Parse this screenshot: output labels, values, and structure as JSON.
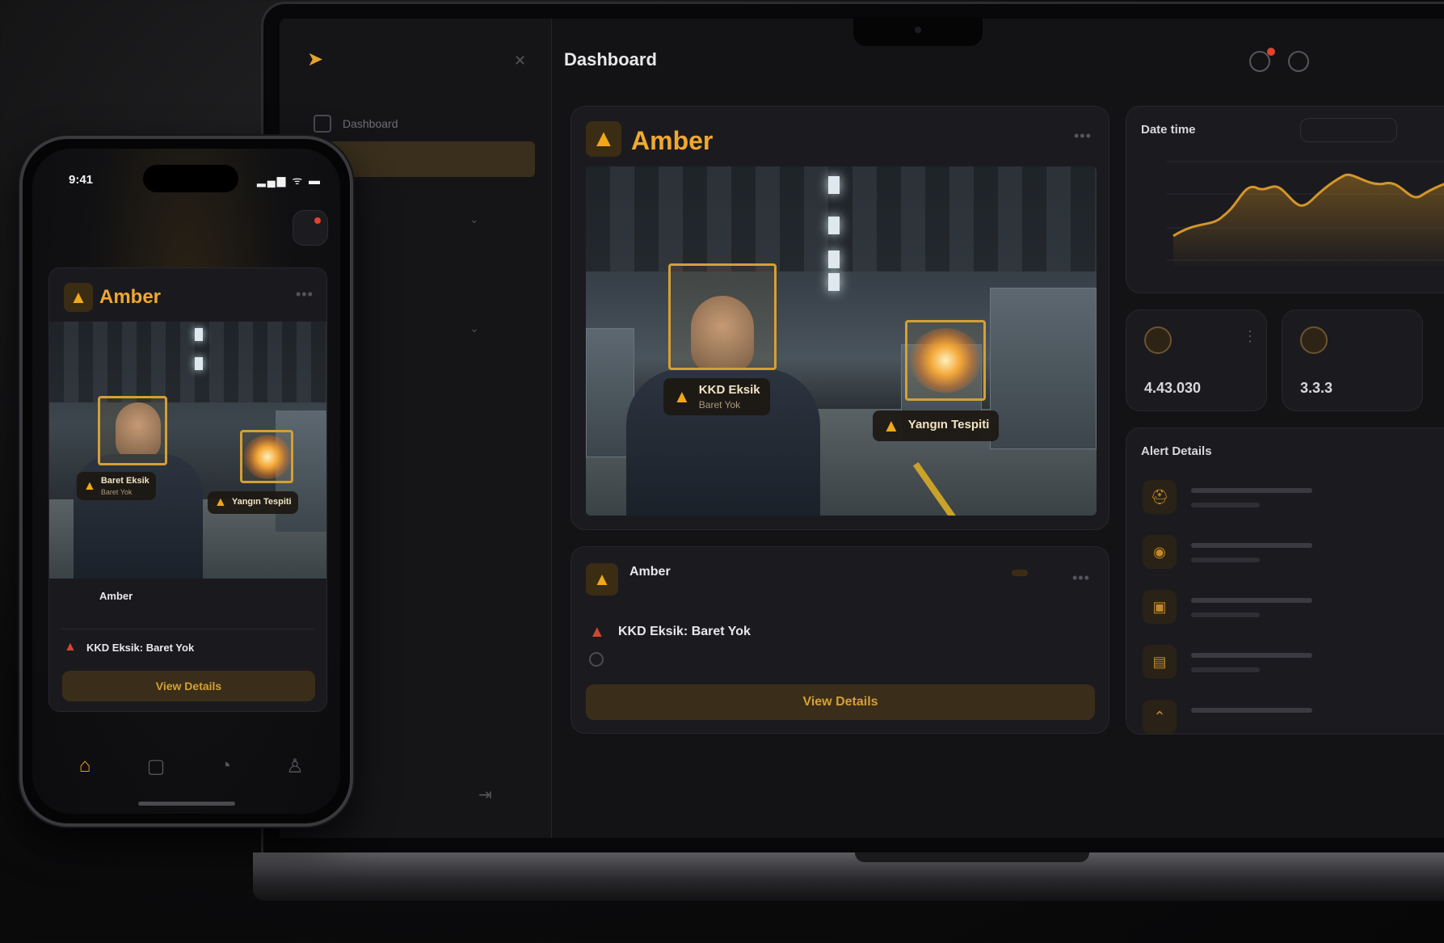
{
  "dashboard": {
    "header_title": "Dashboard",
    "nav": [
      {
        "label": "Dashboard",
        "icon": "grid-icon"
      },
      {
        "label": "",
        "icon": "video-icon"
      }
    ],
    "feed": {
      "title": "Amber",
      "detections": [
        {
          "label": "KKD Eksik",
          "sub": "Baret Yok"
        },
        {
          "label": "Yangın Tespiti",
          "sub": ""
        }
      ]
    },
    "detail": {
      "name": "Amber",
      "time": "",
      "badge": "",
      "alert": "KKD Eksik: Baret Yok",
      "detected": "",
      "button": "View Details"
    },
    "chart_card": {
      "title": "Date time",
      "pill": ""
    },
    "stats": [
      {
        "label": "",
        "value": "4.43.030"
      },
      {
        "label": "",
        "value": "3.3.3"
      }
    ],
    "alert_details_title": "Alert Details",
    "colors": {
      "accent": "#f0a830",
      "danger": "#d0462e",
      "bg": "#131316"
    }
  },
  "phone": {
    "time": "9:41",
    "status_icons": "▂▄▆ ᯤ ▬",
    "card_title": "Amber",
    "detections": [
      {
        "label": "Baret Eksik",
        "sub": "Baret Yok"
      },
      {
        "label": "Yangın Tespiti",
        "sub": ""
      }
    ],
    "item_name": "Amber",
    "item_time": "",
    "alert": "KKD Eksik: Baret Yok",
    "button": "View Details",
    "tabs": [
      "home-icon",
      "grid-icon",
      "bell-icon",
      "user-icon"
    ]
  }
}
